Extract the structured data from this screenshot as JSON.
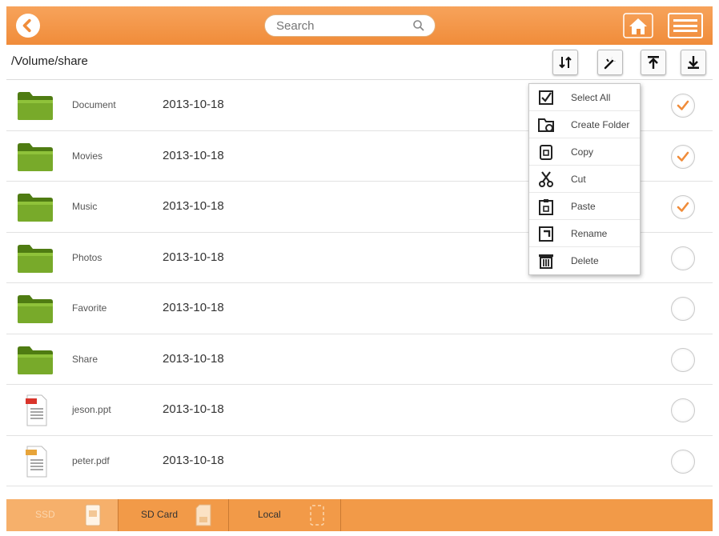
{
  "header": {
    "search_placeholder": "Search",
    "back_icon": "back-arrow-icon",
    "home_icon": "home-icon",
    "menu_icon": "list-menu-icon"
  },
  "path": "/Volume/share",
  "toolbar": {
    "buttons": [
      "sort-icon",
      "tools-icon",
      "upload-icon",
      "download-icon"
    ]
  },
  "files": [
    {
      "name": "Document",
      "date": "2013-10-18",
      "type": "folder",
      "checked": true
    },
    {
      "name": "Movies",
      "date": "2013-10-18",
      "type": "folder",
      "checked": true
    },
    {
      "name": "Music",
      "date": "2013-10-18",
      "type": "folder",
      "checked": true
    },
    {
      "name": "Photos",
      "date": "2013-10-18",
      "type": "folder",
      "checked": false
    },
    {
      "name": "Favorite",
      "date": "2013-10-18",
      "type": "folder",
      "checked": false
    },
    {
      "name": "Share",
      "date": "2013-10-18",
      "type": "folder",
      "checked": false
    },
    {
      "name": "jeson.ppt",
      "date": "2013-10-18",
      "type": "ppt",
      "checked": false
    },
    {
      "name": "peter.pdf",
      "date": "2013-10-18",
      "type": "pdf",
      "checked": false
    }
  ],
  "context_menu": {
    "items": [
      {
        "label": "Select All",
        "icon": "select-all-icon"
      },
      {
        "label": "Create Folder",
        "icon": "create-folder-icon"
      },
      {
        "label": "Copy",
        "icon": "copy-icon"
      },
      {
        "label": "Cut",
        "icon": "cut-icon"
      },
      {
        "label": "Paste",
        "icon": "paste-icon"
      },
      {
        "label": "Rename",
        "icon": "rename-icon"
      },
      {
        "label": "Delete",
        "icon": "delete-icon"
      }
    ]
  },
  "bottom_tabs": [
    {
      "label": "SSD",
      "active": true
    },
    {
      "label": "SD Card",
      "active": false
    },
    {
      "label": "Local",
      "active": false
    }
  ],
  "colors": {
    "accent": "#f29a48",
    "folder": "#6b9a22",
    "check": "#f08c3a"
  }
}
